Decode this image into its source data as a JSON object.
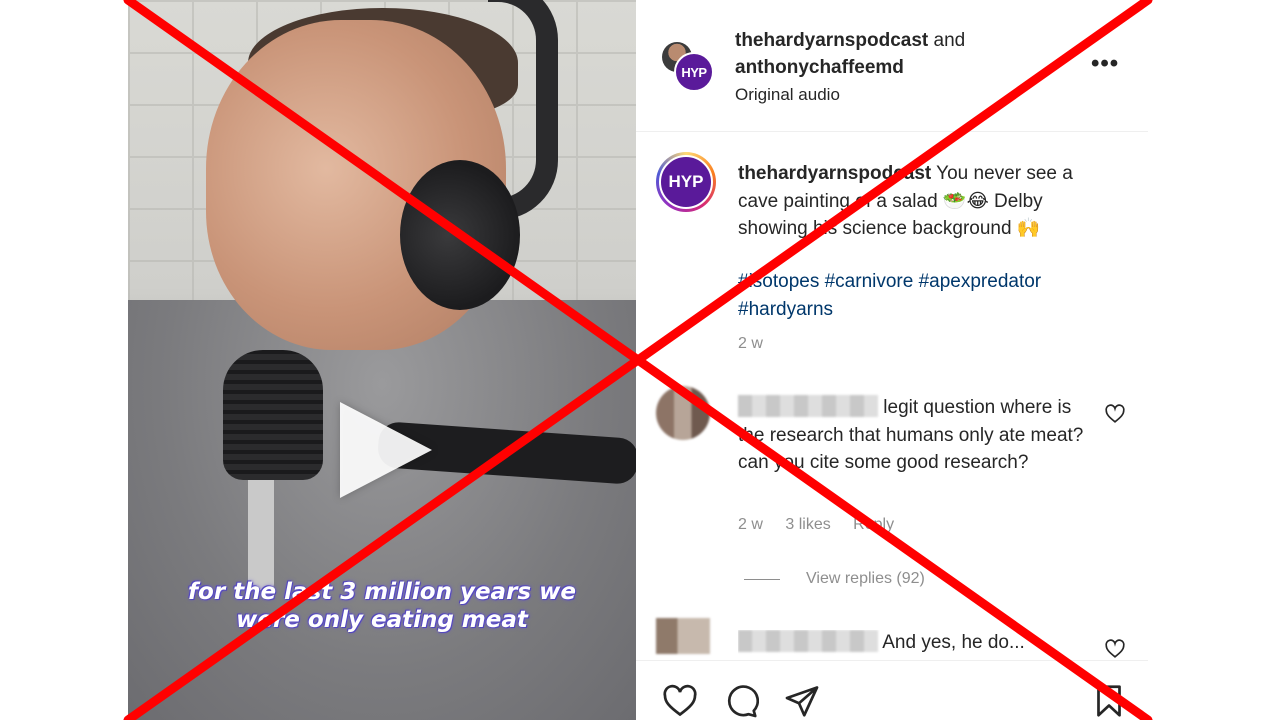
{
  "video": {
    "caption_line1": "for the last 3 million years we",
    "caption_line2": "were only eating meat"
  },
  "header": {
    "user1": "thehardyarnspodcast",
    "joiner": "and",
    "user2": "anthonychaffeemd",
    "subtitle": "Original audio",
    "avatar_text": "HYP",
    "more": "•••"
  },
  "post": {
    "avatar_text": "HYP",
    "username": "thehardyarnspodcast",
    "text": "You never see a cave painting of a salad 🥗😂 Delby showing his science background 🙌",
    "hashtags": "#isotopes #carnivore #apexpredator #hardyarns",
    "time": "2 w"
  },
  "comment": {
    "text": "legit question where is the research that humans only ate meat? can you cite some good research?",
    "time": "2 w",
    "likes": "3 likes",
    "reply": "Reply",
    "view_replies": "View replies (92)"
  },
  "comment2": {
    "text": "And yes, he do..."
  },
  "overlay": {
    "color": "#ff0000"
  }
}
